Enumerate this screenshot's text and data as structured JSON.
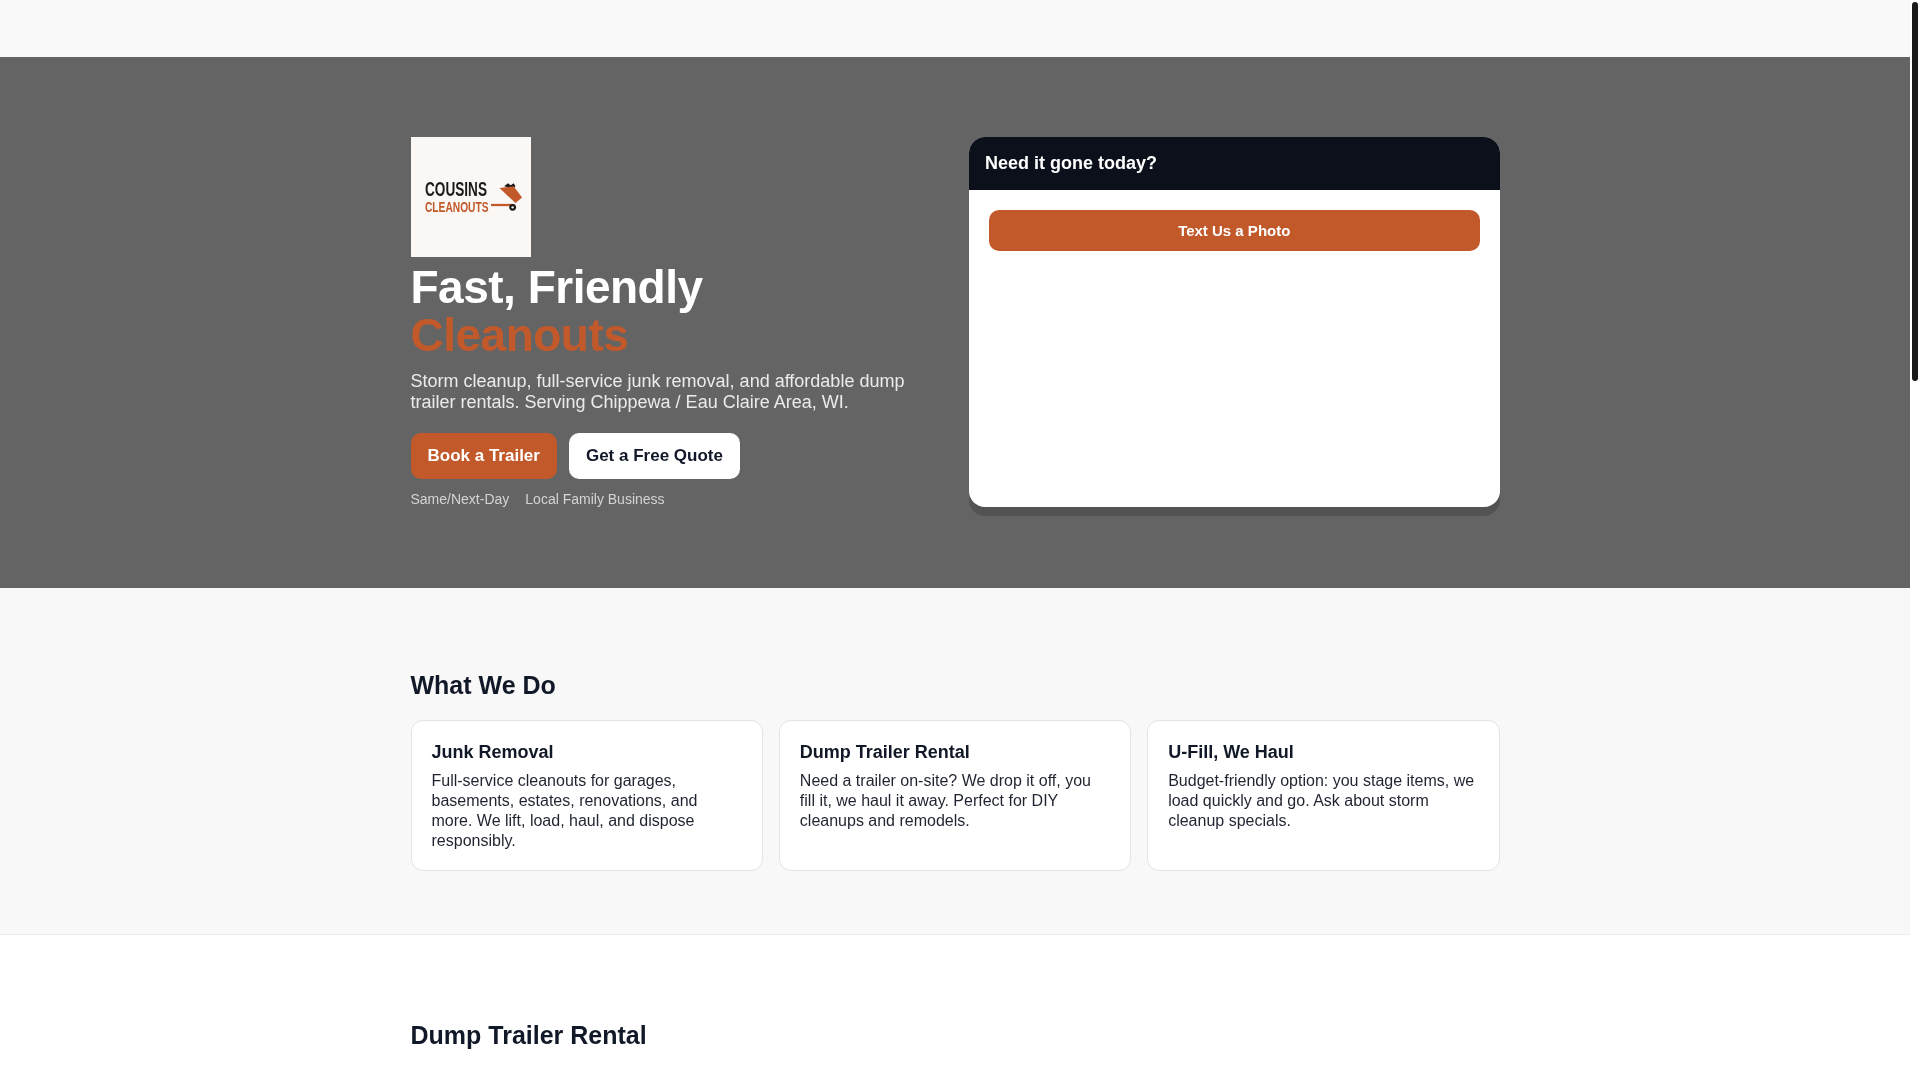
{
  "logo": {
    "line_1": "COUSINS",
    "line_2": "CLEANOUTS"
  },
  "hero": {
    "headline": "Fast, Friendly",
    "headline_accent": "Cleanouts",
    "subtitle": "Storm cleanup, full-service junk removal, and affordable dump trailer rentals. Serving Chippewa / Eau Claire Area, WI.",
    "buttons": [
      {
        "label": "Book a Trailer",
        "kind": "primary"
      },
      {
        "label": "Get a Free Quote",
        "kind": "secondary"
      }
    ],
    "badges": [
      "Same/Next-Day",
      "Local Family Business"
    ]
  },
  "quote_card": {
    "title": "Need it gone today?",
    "button": "Text Us a Photo"
  },
  "what_we_do": {
    "heading": "What We Do",
    "services": [
      {
        "title": "Junk Removal",
        "description": "Full-service cleanouts for garages, basements, estates, renovations, and more. We lift, load, haul, and dispose responsibly."
      },
      {
        "title": "Dump Trailer Rental",
        "description": "Need a trailer on-site? We drop it off, you fill it, we haul it away. Perfect for DIY cleanups and remodels."
      },
      {
        "title": "U-Fill, We Haul",
        "description": "Budget-friendly option: you stage items, we load quickly and go. Ask about storm cleanup specials."
      }
    ]
  },
  "dump_trailer_rental": {
    "heading": "Dump Trailer Rental"
  }
}
